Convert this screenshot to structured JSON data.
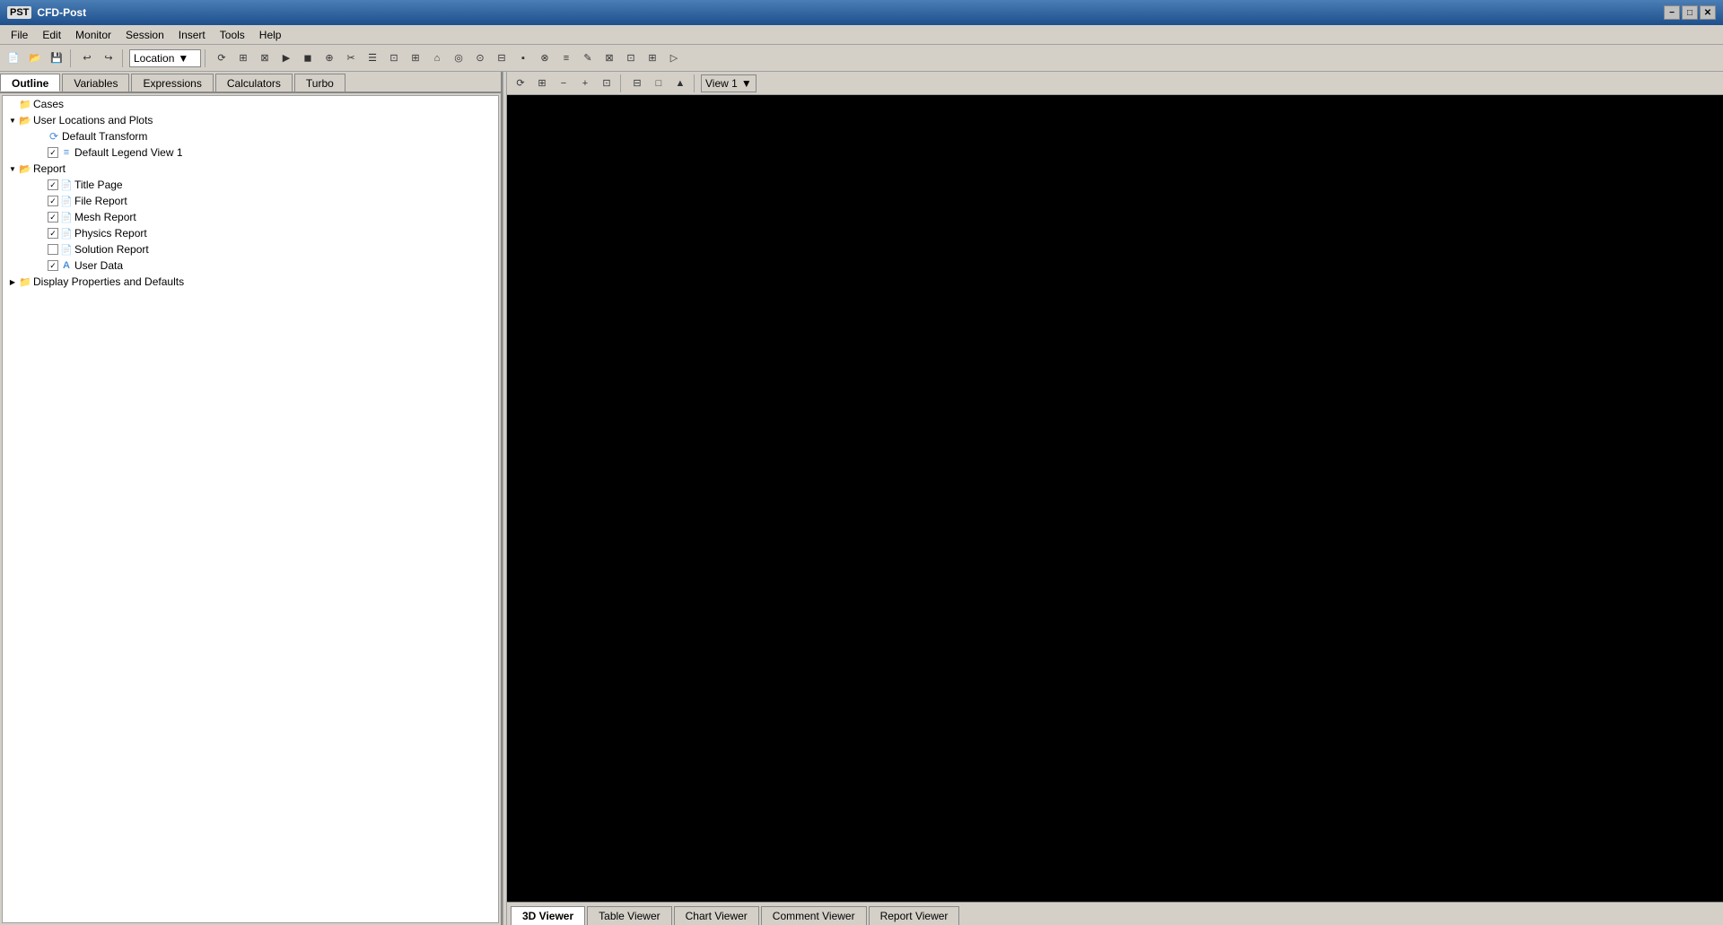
{
  "titleBar": {
    "icon": "PST",
    "title": "CFD-Post",
    "minimizeLabel": "−",
    "maximizeLabel": "□",
    "closeLabel": "✕"
  },
  "menuBar": {
    "items": [
      "File",
      "Edit",
      "Monitor",
      "Session",
      "Insert",
      "Tools",
      "Help"
    ]
  },
  "toolbar": {
    "locationLabel": "Location",
    "locationDropdownArrow": "▼"
  },
  "tabs": {
    "items": [
      "Outline",
      "Variables",
      "Expressions",
      "Calculators",
      "Turbo"
    ],
    "activeIndex": 0
  },
  "outline": {
    "tree": [
      {
        "id": "cases",
        "label": "Cases",
        "indent": 0,
        "hasArrow": false,
        "expanded": false,
        "iconType": "folder-open",
        "showCheckbox": false,
        "checked": false
      },
      {
        "id": "user-locations",
        "label": "User Locations and Plots",
        "indent": 0,
        "hasArrow": true,
        "expanded": true,
        "arrowDown": true,
        "iconType": "folder-open",
        "showCheckbox": false,
        "checked": false
      },
      {
        "id": "default-transform",
        "label": "Default Transform",
        "indent": 2,
        "hasArrow": false,
        "expanded": false,
        "iconType": "transform",
        "showCheckbox": false,
        "checked": false
      },
      {
        "id": "default-legend",
        "label": "Default Legend View 1",
        "indent": 2,
        "hasArrow": false,
        "expanded": false,
        "iconType": "legend",
        "showCheckbox": true,
        "checked": true
      },
      {
        "id": "report",
        "label": "Report",
        "indent": 0,
        "hasArrow": true,
        "expanded": true,
        "arrowDown": true,
        "iconType": "folder-open",
        "showCheckbox": false,
        "checked": false
      },
      {
        "id": "title-page",
        "label": "Title Page",
        "indent": 2,
        "hasArrow": false,
        "expanded": false,
        "iconType": "report-item",
        "showCheckbox": true,
        "checked": true
      },
      {
        "id": "file-report",
        "label": "File Report",
        "indent": 2,
        "hasArrow": false,
        "expanded": false,
        "iconType": "report-item",
        "showCheckbox": true,
        "checked": true
      },
      {
        "id": "mesh-report",
        "label": "Mesh Report",
        "indent": 2,
        "hasArrow": false,
        "expanded": false,
        "iconType": "report-item",
        "showCheckbox": true,
        "checked": true
      },
      {
        "id": "physics-report",
        "label": "Physics Report",
        "indent": 2,
        "hasArrow": false,
        "expanded": false,
        "iconType": "report-item",
        "showCheckbox": true,
        "checked": true
      },
      {
        "id": "solution-report",
        "label": "Solution Report",
        "indent": 2,
        "hasArrow": false,
        "expanded": false,
        "iconType": "report-item",
        "showCheckbox": false,
        "checked": false
      },
      {
        "id": "user-data",
        "label": "User Data",
        "indent": 2,
        "hasArrow": false,
        "expanded": false,
        "iconType": "user-data",
        "showCheckbox": true,
        "checked": true
      },
      {
        "id": "display-props",
        "label": "Display Properties and Defaults",
        "indent": 0,
        "hasArrow": true,
        "expanded": false,
        "arrowDown": false,
        "iconType": "folder-open",
        "showCheckbox": false,
        "checked": false
      }
    ]
  },
  "viewToolbar": {
    "viewSelectorLabel": "View 1",
    "dropdownArrow": "▼"
  },
  "bottomTabs": {
    "items": [
      "3D Viewer",
      "Table Viewer",
      "Chart Viewer",
      "Comment Viewer",
      "Report Viewer"
    ],
    "activeIndex": 0
  },
  "icons": {
    "folder": "📁",
    "folderOpen": "📂",
    "transform": "⟳",
    "legend": "≡",
    "reportItem": "📄",
    "userData": "A",
    "checkMark": "✓"
  }
}
